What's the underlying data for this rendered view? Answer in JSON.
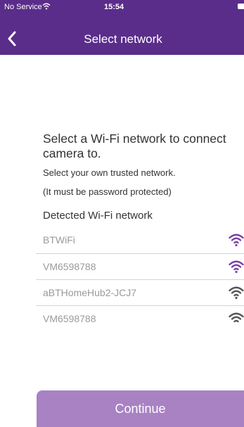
{
  "status_bar": {
    "carrier": "No Service",
    "time": "15:54"
  },
  "nav": {
    "title": "Select network",
    "back_icon": "chevron-left-icon"
  },
  "content": {
    "heading": "Select a Wi-Fi network to connect camera to.",
    "instruction": "Select your own trusted network.",
    "note": "(It must be password protected)",
    "detected_label": "Detected Wi-Fi network"
  },
  "networks": [
    {
      "name": "BTWiFi",
      "icon": "wifi-icon",
      "color": "#7b3fa6"
    },
    {
      "name": "VM6598788",
      "icon": "wifi-icon",
      "color": "#7b3fa6"
    },
    {
      "name": "aBTHomeHub2-JCJ7",
      "icon": "wifi-icon",
      "color": "#555555"
    },
    {
      "name": "VM6598788",
      "icon": "wifi-icon",
      "color": "#555555"
    }
  ],
  "continue_label": "Continue",
  "colors": {
    "header": "#5a2d8a",
    "button": "#a882c3"
  }
}
